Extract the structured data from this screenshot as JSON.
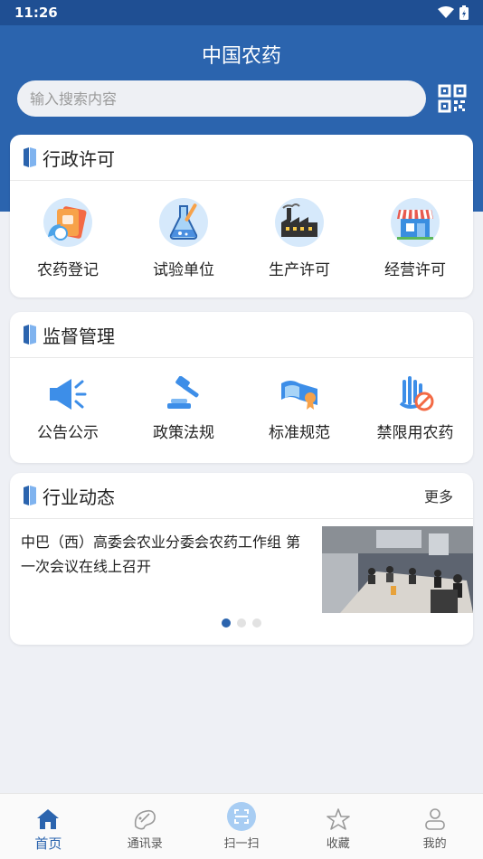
{
  "status": {
    "time": "11:26"
  },
  "header": {
    "title": "中国农药",
    "search_placeholder": "输入搜索内容"
  },
  "sections": {
    "admin": {
      "title": "行政许可",
      "items": [
        "农药登记",
        "试验单位",
        "生产许可",
        "经营许可"
      ]
    },
    "supervision": {
      "title": "监督管理",
      "items": [
        "公告公示",
        "政策法规",
        "标准规范",
        "禁限用农药"
      ]
    },
    "news": {
      "title": "行业动态",
      "more": "更多",
      "headline": "中巴（西）高委会农业分委会农药工作组 第一次会议在线上召开",
      "carousel_active_index": 0
    }
  },
  "tabbar": [
    "首页",
    "通讯录",
    "扫一扫",
    "收藏",
    "我的"
  ],
  "colors": {
    "primary": "#2b64ae",
    "status_bar": "#1f4f93",
    "icon_blue": "#3d8ee8"
  }
}
